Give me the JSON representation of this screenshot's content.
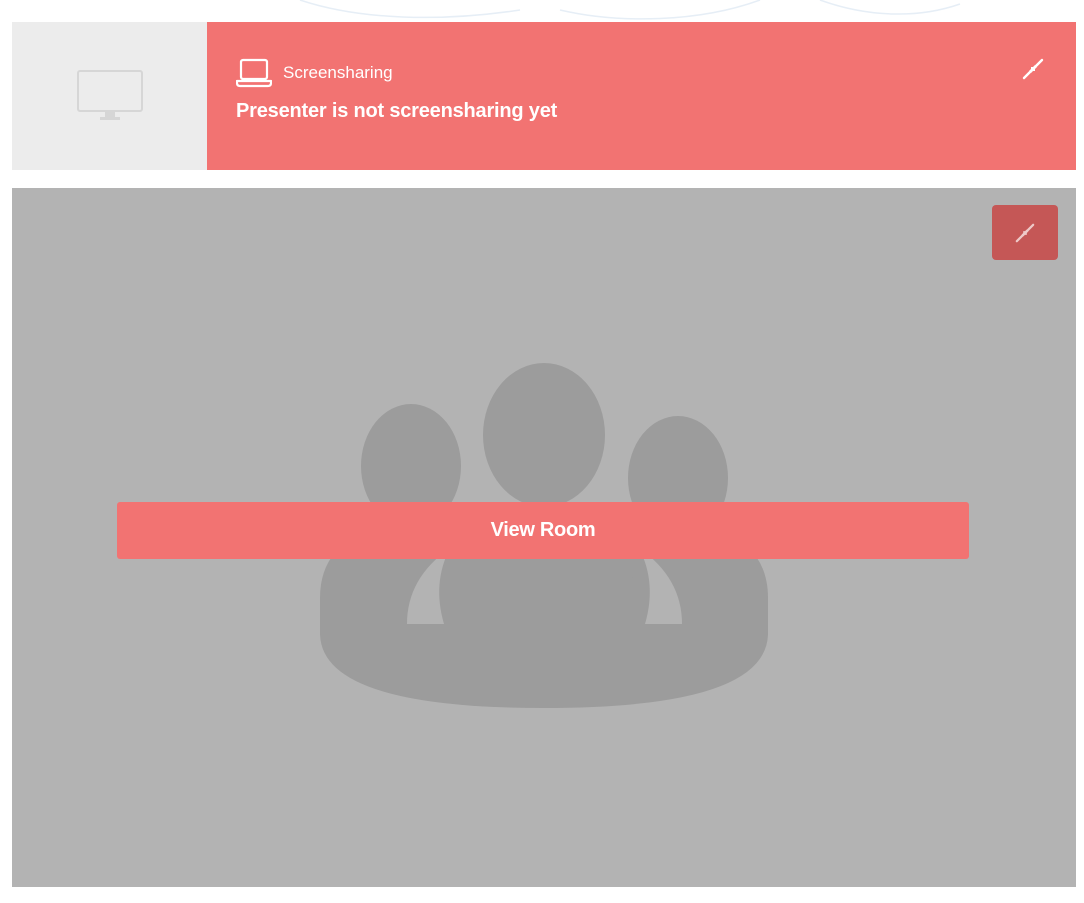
{
  "screenshare": {
    "label": "Screenshare Label",
    "title": "Screensharing",
    "status": "Presenter is not screensharing yet",
    "thumbnail_icon": "monitor-icon",
    "title_icon": "laptop-icon",
    "collapse_icon": "compress-arrows-icon"
  },
  "room": {
    "view_button_label": "View Room",
    "placeholder_icon": "group-users-icon",
    "collapse_icon": "compress-arrows-icon"
  },
  "colors": {
    "accent": "#f27372",
    "accent_dark": "#c55756",
    "thumb_bg": "#ececec",
    "room_bg": "#b3b3b3",
    "silhouette": "#9c9c9c"
  }
}
